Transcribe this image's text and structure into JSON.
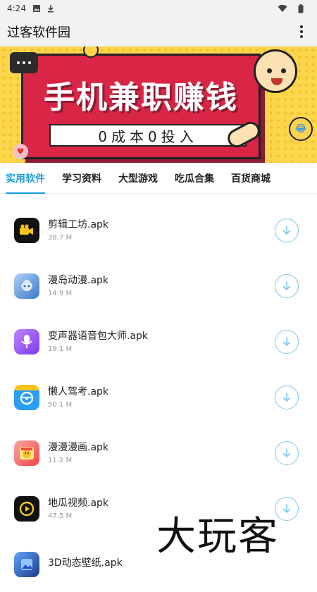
{
  "status_bar": {
    "time": "4:24",
    "left_icons": [
      "image-icon",
      "download-icon"
    ],
    "right_icons": [
      "wifi-icon",
      "battery-icon"
    ]
  },
  "app_bar": {
    "title": "过客软件园",
    "menu_icon": "more-vert-icon"
  },
  "banner": {
    "headline": "手机兼职赚钱",
    "subline": "0成本0投入",
    "colors": {
      "background": "#fbd54a",
      "panel": "#d92646"
    }
  },
  "tabs": [
    {
      "label": "实用软件",
      "active": true
    },
    {
      "label": "学习资料",
      "active": false
    },
    {
      "label": "大型游戏",
      "active": false
    },
    {
      "label": "吃瓜合集",
      "active": false
    },
    {
      "label": "百货商城",
      "active": false
    }
  ],
  "accent_color": "#1a9fe0",
  "apps": [
    {
      "name": "剪辑工坊.apk",
      "size": "38.7 M",
      "icon": "video-camera-icon",
      "color": "#111111"
    },
    {
      "name": "漫岛动漫.apk",
      "size": "14.9 M",
      "icon": "anime-girl-icon",
      "color": "#7fb0e8"
    },
    {
      "name": "变声器语音包大师.apk",
      "size": "19.1 M",
      "icon": "microphone-icon",
      "color": "#a855f7"
    },
    {
      "name": "懒人驾考.apk",
      "size": "50.1 M",
      "icon": "steering-wheel-icon",
      "color": "#2a9df4"
    },
    {
      "name": "漫漫漫画.apk",
      "size": "11.2 M",
      "icon": "comic-icon",
      "color": "#ef4444"
    },
    {
      "name": "地瓜视频.apk",
      "size": "47.5 M",
      "icon": "play-icon",
      "color": "#111111"
    },
    {
      "name": "3D动态壁纸.apk",
      "size": "",
      "icon": "wallpaper-icon",
      "color": "#3b5bdb"
    }
  ],
  "download_icon": "download-circle-icon",
  "watermark": "大玩客"
}
